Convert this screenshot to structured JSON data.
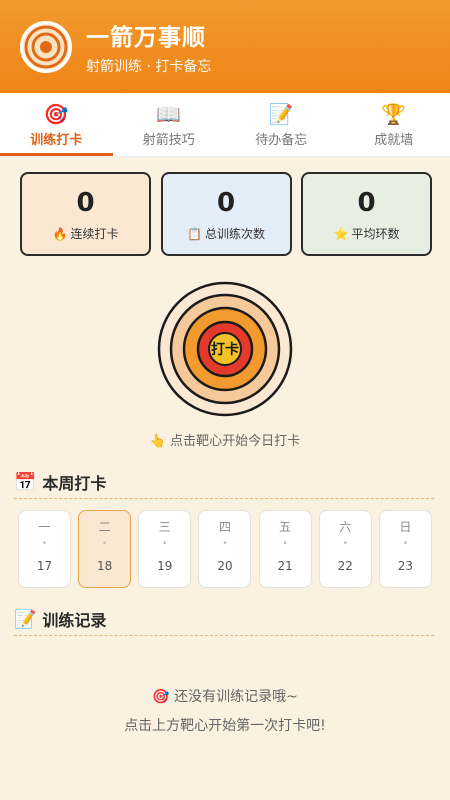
{
  "header": {
    "title": "一箭万事顺",
    "subtitle": "射箭训练 · 打卡备忘",
    "logo_icon": "target-icon"
  },
  "tabs": [
    {
      "label": "训练打卡",
      "icon": "🎯",
      "icon_name": "target-icon",
      "active": true
    },
    {
      "label": "射箭技巧",
      "icon": "📖",
      "icon_name": "book-icon",
      "active": false
    },
    {
      "label": "待办备忘",
      "icon": "📝",
      "icon_name": "memo-icon",
      "active": false
    },
    {
      "label": "成就墙",
      "icon": "🏆",
      "icon_name": "trophy-icon",
      "active": false
    }
  ],
  "stats": [
    {
      "value": "0",
      "icon": "🔥",
      "label": "连续打卡"
    },
    {
      "value": "0",
      "icon": "📋",
      "label": "总训练次数"
    },
    {
      "value": "0",
      "icon": "⭐",
      "label": "平均环数"
    }
  ],
  "target": {
    "label": "打卡",
    "hint": "👆 点击靶心开始今日打卡"
  },
  "week": {
    "title": "本周打卡",
    "icon": "📅",
    "days": [
      {
        "name": "一",
        "dot": "•",
        "date": "17",
        "today": false
      },
      {
        "name": "二",
        "dot": "•",
        "date": "18",
        "today": true
      },
      {
        "name": "三",
        "dot": "•",
        "date": "19",
        "today": false
      },
      {
        "name": "四",
        "dot": "•",
        "date": "20",
        "today": false
      },
      {
        "name": "五",
        "dot": "•",
        "date": "21",
        "today": false
      },
      {
        "name": "六",
        "dot": "•",
        "date": "22",
        "today": false
      },
      {
        "name": "日",
        "dot": "•",
        "date": "23",
        "today": false
      }
    ]
  },
  "records": {
    "title": "训练记录",
    "icon": "📝",
    "empty_line1": "🎯 还没有训练记录哦~",
    "empty_line2": "点击上方靶心开始第一次打卡吧!"
  },
  "colors": {
    "header": "#ef8416",
    "accent": "#e0621a",
    "background": "#fbf1e1"
  }
}
